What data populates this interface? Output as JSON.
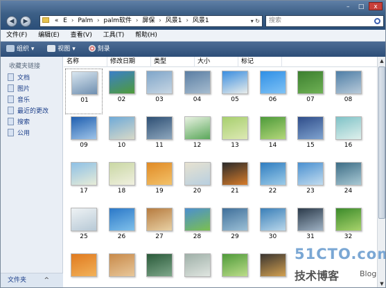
{
  "address": {
    "segments": [
      "«",
      "E",
      "Palm",
      "palm软件",
      "屏保",
      "风景1",
      "风景1"
    ],
    "separators": [
      "›",
      "›",
      "›",
      "›",
      "›"
    ]
  },
  "search": {
    "placeholder": "搜索"
  },
  "window_controls": {
    "minimize": "–",
    "maximize": "□",
    "close": "x"
  },
  "menu": {
    "items": [
      "文件(F)",
      "编辑(E)",
      "查看(V)",
      "工具(T)",
      "帮助(H)"
    ]
  },
  "toolbar": {
    "organize": "组织",
    "views": "视图",
    "burn": "刻录",
    "dropdown": "▾"
  },
  "sidebar": {
    "header": "收藏夹链接",
    "items": [
      "文档",
      "图片",
      "音乐",
      "最近的更改",
      "搜索",
      "公用"
    ],
    "footer": "文件夹",
    "footer_arrow": "^"
  },
  "columns": [
    "名称",
    "修改日期",
    "类型",
    "大小",
    "标记"
  ],
  "files": [
    {
      "label": "01",
      "colors": [
        "#d9e6f0",
        "#6f8fb0"
      ]
    },
    {
      "label": "02",
      "colors": [
        "#3a7fc8",
        "#4f9b3a"
      ]
    },
    {
      "label": "03",
      "colors": [
        "#7fa5c9",
        "#c7d6e3"
      ]
    },
    {
      "label": "04",
      "colors": [
        "#5b7ea3",
        "#a6bccf"
      ]
    },
    {
      "label": "05",
      "colors": [
        "#3a8ee0",
        "#e8ecea"
      ]
    },
    {
      "label": "06",
      "colors": [
        "#2f8fe6",
        "#7fc2f5"
      ]
    },
    {
      "label": "07",
      "colors": [
        "#3c7f2f",
        "#6fb155"
      ]
    },
    {
      "label": "08",
      "colors": [
        "#4e7ea6",
        "#b8cad9"
      ]
    },
    {
      "label": "09",
      "colors": [
        "#1f5fb0",
        "#9fc4e8"
      ]
    },
    {
      "label": "10",
      "colors": [
        "#6faad8",
        "#d8d9c8"
      ]
    },
    {
      "label": "11",
      "colors": [
        "#2e4f74",
        "#8ea7bd"
      ]
    },
    {
      "label": "12",
      "colors": [
        "#e9f2e2",
        "#5aa75a"
      ]
    },
    {
      "label": "13",
      "colors": [
        "#a7cf6e",
        "#dde9b4"
      ]
    },
    {
      "label": "14",
      "colors": [
        "#4d9a3a",
        "#b4d77a"
      ]
    },
    {
      "label": "15",
      "colors": [
        "#2f4d8a",
        "#7fa3cf"
      ]
    },
    {
      "label": "16",
      "colors": [
        "#7fc2c7",
        "#dff0ec"
      ]
    },
    {
      "label": "17",
      "colors": [
        "#8ec0e6",
        "#e7ecd8"
      ]
    },
    {
      "label": "18",
      "colors": [
        "#c9d7a3",
        "#f0f0e0"
      ]
    },
    {
      "label": "19",
      "colors": [
        "#e08a25",
        "#f3c26a"
      ]
    },
    {
      "label": "20",
      "colors": [
        "#e7e2d0",
        "#b8cfe0"
      ]
    },
    {
      "label": "21",
      "colors": [
        "#2a2a2a",
        "#d77c2a"
      ]
    },
    {
      "label": "22",
      "colors": [
        "#2f7dc0",
        "#9ccbe8"
      ]
    },
    {
      "label": "23",
      "colors": [
        "#4a90d0",
        "#c2dcef"
      ]
    },
    {
      "label": "24",
      "colors": [
        "#3d6d86",
        "#a9c9d4"
      ]
    },
    {
      "label": "25",
      "colors": [
        "#eef2f4",
        "#b7c9d6"
      ]
    },
    {
      "label": "26",
      "colors": [
        "#2b78c8",
        "#7fc0ea"
      ]
    },
    {
      "label": "27",
      "colors": [
        "#b67b3f",
        "#e8d1a5"
      ]
    },
    {
      "label": "28",
      "colors": [
        "#4b8fd0",
        "#7bbf4f"
      ]
    },
    {
      "label": "29",
      "colors": [
        "#3f6f9a",
        "#9cc0d6"
      ]
    },
    {
      "label": "30",
      "colors": [
        "#3a7fb8",
        "#b9d7ea"
      ]
    },
    {
      "label": "31",
      "colors": [
        "#2b3a4a",
        "#9fb2c4"
      ]
    },
    {
      "label": "32",
      "colors": [
        "#3b8a2a",
        "#a8d36c"
      ]
    },
    {
      "label": "",
      "colors": [
        "#e07a1f",
        "#f2b25a"
      ]
    },
    {
      "label": "",
      "colors": [
        "#c88a4a",
        "#e8c79a"
      ]
    },
    {
      "label": "",
      "colors": [
        "#2a5a3a",
        "#7ea78a"
      ]
    },
    {
      "label": "",
      "colors": [
        "#9fb0a8",
        "#dfe5e0"
      ]
    },
    {
      "label": "",
      "colors": [
        "#4f9a3a",
        "#bcdd8a"
      ]
    },
    {
      "label": "",
      "colors": [
        "#3a3530",
        "#d2a050"
      ]
    }
  ],
  "watermark": {
    "line1": "51CTO.com",
    "line2": "技术博客",
    "line3": "Blog"
  }
}
